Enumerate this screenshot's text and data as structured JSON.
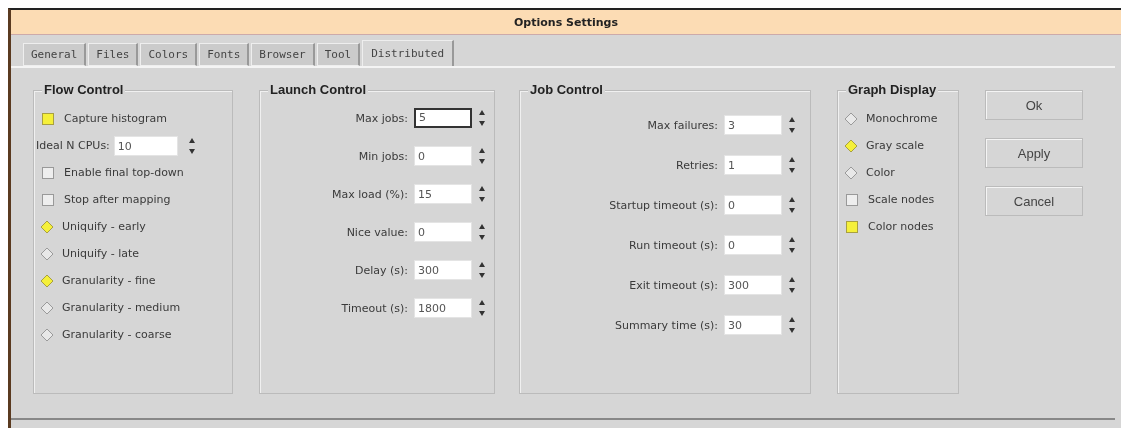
{
  "window": {
    "title": "Options Settings"
  },
  "tabs": [
    {
      "label": "General",
      "selected": false
    },
    {
      "label": "Files",
      "selected": false
    },
    {
      "label": "Colors",
      "selected": false
    },
    {
      "label": "Fonts",
      "selected": false
    },
    {
      "label": "Browser",
      "selected": false
    },
    {
      "label": "Tool",
      "selected": false
    },
    {
      "label": "Distributed",
      "selected": true
    }
  ],
  "flow_control": {
    "title": "Flow Control",
    "items": [
      {
        "kind": "checkbox",
        "label": "Capture histogram",
        "checked": true
      },
      {
        "kind": "spin",
        "label": "Ideal N CPUs:",
        "value": "10"
      },
      {
        "kind": "checkbox",
        "label": "Enable final top-down",
        "checked": false
      },
      {
        "kind": "checkbox",
        "label": "Stop after mapping",
        "checked": false
      },
      {
        "kind": "radio",
        "label": "Uniquify - early",
        "selected": true
      },
      {
        "kind": "radio",
        "label": "Uniquify - late",
        "selected": false
      },
      {
        "kind": "radio",
        "label": "Granularity - fine",
        "selected": true
      },
      {
        "kind": "radio",
        "label": "Granularity - medium",
        "selected": false
      },
      {
        "kind": "radio",
        "label": "Granularity - coarse",
        "selected": false
      }
    ]
  },
  "launch_control": {
    "title": "Launch Control",
    "fields": [
      {
        "label": "Max jobs:",
        "value": "5",
        "focused": true
      },
      {
        "label": "Min jobs:",
        "value": "0",
        "focused": false
      },
      {
        "label": "Max load (%):",
        "value": "15",
        "focused": false
      },
      {
        "label": "Nice value:",
        "value": "0",
        "focused": false
      },
      {
        "label": "Delay (s):",
        "value": "300",
        "focused": false
      },
      {
        "label": "Timeout (s):",
        "value": "1800",
        "focused": false
      }
    ]
  },
  "job_control": {
    "title": "Job Control",
    "fields": [
      {
        "label": "Max failures:",
        "value": "3",
        "focused": false
      },
      {
        "label": "Retries:",
        "value": "1",
        "focused": false
      },
      {
        "label": "Startup timeout (s):",
        "value": "0",
        "focused": false
      },
      {
        "label": "Run timeout (s):",
        "value": "0",
        "focused": false
      },
      {
        "label": "Exit timeout (s):",
        "value": "300",
        "focused": false
      },
      {
        "label": "Summary time (s):",
        "value": "30",
        "focused": false
      }
    ]
  },
  "graph_display": {
    "title": "Graph Display",
    "items": [
      {
        "kind": "radio",
        "label": "Monochrome",
        "selected": false
      },
      {
        "kind": "radio",
        "label": "Gray scale",
        "selected": true
      },
      {
        "kind": "radio",
        "label": "Color",
        "selected": false
      },
      {
        "kind": "checkbox",
        "label": "Scale nodes",
        "checked": false
      },
      {
        "kind": "checkbox",
        "label": "Color nodes",
        "checked": true
      }
    ]
  },
  "buttons": [
    "Ok",
    "Apply",
    "Cancel"
  ]
}
